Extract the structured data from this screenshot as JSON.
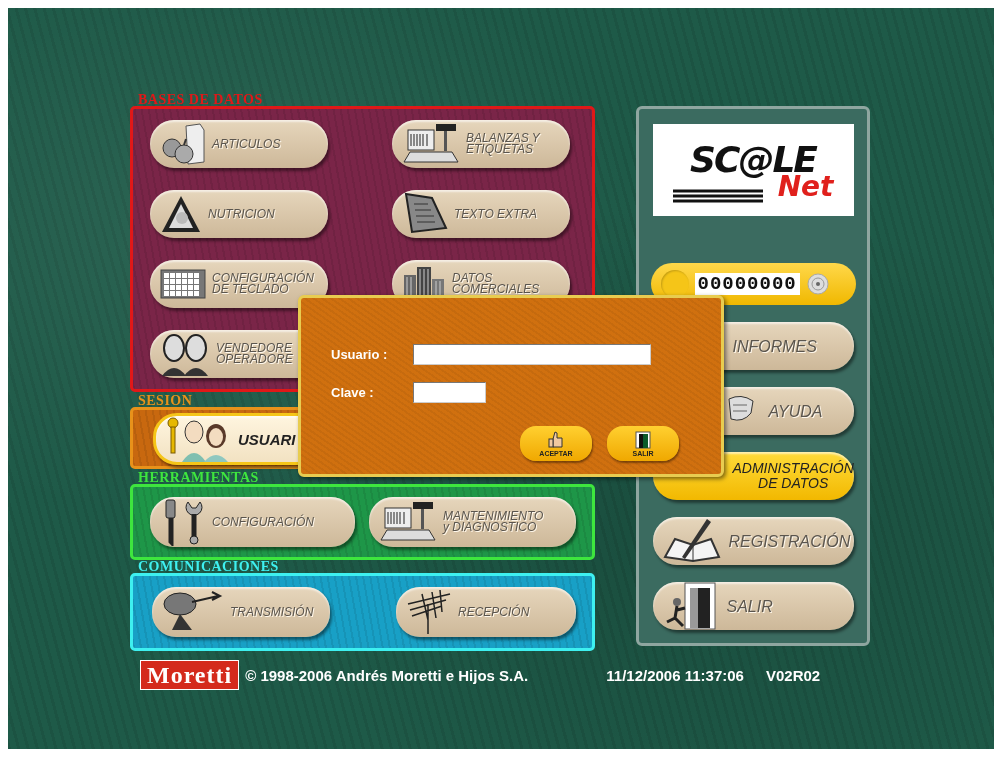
{
  "sections": [
    {
      "title": "BASES DE DATOS",
      "color": "#e01818",
      "items": [
        {
          "label": "ARTICULOS",
          "highlighted": false
        },
        {
          "label": "BALANZAS Y ETIQUETAS",
          "highlighted": false
        },
        {
          "label": "NUTRICION",
          "highlighted": false
        },
        {
          "label": "TEXTO EXTRA",
          "highlighted": false
        },
        {
          "label": "CONFIGURACIÓN DE TECLADO",
          "highlighted": false
        },
        {
          "label": "DATOS COMERCIALES",
          "highlighted": false
        },
        {
          "label": "VENDEDORE OPERADORE",
          "highlighted": false
        }
      ]
    },
    {
      "title": "SESION",
      "color": "#e8921a",
      "items": [
        {
          "label": "USUARI",
          "highlighted": true
        }
      ]
    },
    {
      "title": "HERRAMIENTAS",
      "color": "#3ee63e",
      "items": [
        {
          "label": "CONFIGURACIÓN",
          "highlighted": false
        },
        {
          "label": "MANTENIMIENTO y DIAGNOSTICO",
          "highlighted": false
        }
      ]
    },
    {
      "title": "COMUNICACIONES",
      "color": "#3ef0f0",
      "items": [
        {
          "label": "TRANSMISIÓN",
          "highlighted": false
        },
        {
          "label": "RECEPCIÓN",
          "highlighted": false
        }
      ]
    }
  ],
  "side_panel": {
    "logo": {
      "word": "SC@LE",
      "sub": "Net"
    },
    "counter": "00000000",
    "menu": [
      {
        "label": "INFORMES",
        "highlighted": false
      },
      {
        "label": "AYUDA",
        "highlighted": false
      },
      {
        "label": "ADMINISTRACIÓN DE DATOS",
        "highlighted": true
      },
      {
        "label": "REGISTRACIÓN",
        "highlighted": false
      },
      {
        "label": "SALIR",
        "highlighted": false
      }
    ]
  },
  "footer": {
    "brand": "Moretti",
    "copyright": "© 1998-2006 Andrés Moretti e Hijos S.A.",
    "datetime": "11/12/2006 11:37:06",
    "version": "V02R02"
  },
  "login_dialog": {
    "fields": [
      {
        "label": "Usuario :"
      },
      {
        "label": "Clave :"
      }
    ],
    "buttons": [
      "ACEPTAR",
      "SALIR"
    ]
  }
}
